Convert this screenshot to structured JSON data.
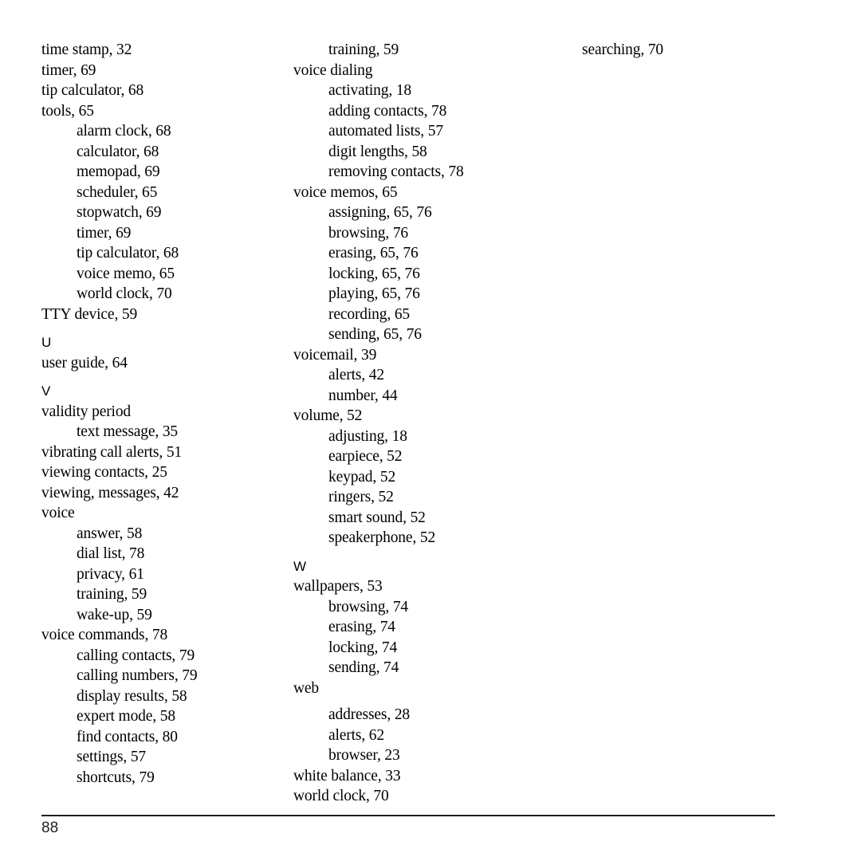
{
  "document": {
    "type": "book-index-page",
    "page_number": "88"
  },
  "footer": {
    "page_number": "88"
  },
  "columns": [
    {
      "id": "column-1",
      "entries": [
        {
          "text": "time stamp, 32",
          "level": 1
        },
        {
          "text": "timer, 69",
          "level": 1
        },
        {
          "text": "tip calculator, 68",
          "level": 1
        },
        {
          "text": "tools, 65",
          "level": 1
        },
        {
          "text": "alarm clock, 68",
          "level": 2
        },
        {
          "text": "calculator, 68",
          "level": 2
        },
        {
          "text": "memopad, 69",
          "level": 2
        },
        {
          "text": "scheduler, 65",
          "level": 2
        },
        {
          "text": "stopwatch, 69",
          "level": 2
        },
        {
          "text": "timer, 69",
          "level": 2
        },
        {
          "text": "tip calculator, 68",
          "level": 2
        },
        {
          "text": "voice memo, 65",
          "level": 2
        },
        {
          "text": "world clock, 70",
          "level": 2
        },
        {
          "text": "TTY device, 59",
          "level": 1
        },
        {
          "text": "U",
          "level": 0,
          "kind": "section-letter"
        },
        {
          "text": "user guide, 64",
          "level": 1
        },
        {
          "text": "V",
          "level": 0,
          "kind": "section-letter"
        },
        {
          "text": "validity period",
          "level": 1
        },
        {
          "text": "text message, 35",
          "level": 2
        },
        {
          "text": "vibrating call alerts, 51",
          "level": 1
        },
        {
          "text": "viewing contacts, 25",
          "level": 1
        },
        {
          "text": "viewing, messages, 42",
          "level": 1
        },
        {
          "text": "voice",
          "level": 1
        },
        {
          "text": "answer, 58",
          "level": 2
        },
        {
          "text": "dial list, 78",
          "level": 2
        },
        {
          "text": "privacy, 61",
          "level": 2
        },
        {
          "text": "training, 59",
          "level": 2
        },
        {
          "text": "wake-up, 59",
          "level": 2
        },
        {
          "text": "voice commands, 78",
          "level": 1
        },
        {
          "text": "calling contacts, 79",
          "level": 2
        },
        {
          "text": "calling numbers, 79",
          "level": 2
        },
        {
          "text": "display results, 58",
          "level": 2
        },
        {
          "text": "expert mode, 58",
          "level": 2
        },
        {
          "text": "find contacts, 80",
          "level": 2
        },
        {
          "text": "settings, 57",
          "level": 2
        },
        {
          "text": "shortcuts, 79",
          "level": 2
        }
      ]
    },
    {
      "id": "column-2",
      "entries": [
        {
          "text": "training, 59",
          "level": 2
        },
        {
          "text": "voice dialing",
          "level": 1
        },
        {
          "text": "activating, 18",
          "level": 2
        },
        {
          "text": "adding contacts, 78",
          "level": 2
        },
        {
          "text": "automated lists, 57",
          "level": 2
        },
        {
          "text": "digit lengths, 58",
          "level": 2
        },
        {
          "text": "removing contacts, 78",
          "level": 2
        },
        {
          "text": "voice memos, 65",
          "level": 1
        },
        {
          "text": "assigning, 65, 76",
          "level": 2
        },
        {
          "text": "browsing, 76",
          "level": 2
        },
        {
          "text": "erasing, 65, 76",
          "level": 2
        },
        {
          "text": "locking, 65, 76",
          "level": 2
        },
        {
          "text": "playing, 65, 76",
          "level": 2
        },
        {
          "text": "recording, 65",
          "level": 2
        },
        {
          "text": "sending, 65, 76",
          "level": 2
        },
        {
          "text": "voicemail, 39",
          "level": 1
        },
        {
          "text": "alerts, 42",
          "level": 2
        },
        {
          "text": "number, 44",
          "level": 2
        },
        {
          "text": "volume, 52",
          "level": 1
        },
        {
          "text": "adjusting, 18",
          "level": 2
        },
        {
          "text": "earpiece, 52",
          "level": 2
        },
        {
          "text": "keypad, 52",
          "level": 2
        },
        {
          "text": "ringers, 52",
          "level": 2
        },
        {
          "text": "smart sound, 52",
          "level": 2
        },
        {
          "text": "speakerphone, 52",
          "level": 2
        },
        {
          "text": "W",
          "level": 0,
          "kind": "section-letter"
        },
        {
          "text": "wallpapers, 53",
          "level": 1
        },
        {
          "text": "browsing, 74",
          "level": 2
        },
        {
          "text": "erasing, 74",
          "level": 2
        },
        {
          "text": "locking, 74",
          "level": 2
        },
        {
          "text": "sending, 74",
          "level": 2
        },
        {
          "text": "web",
          "level": 1,
          "gap_after": true
        },
        {
          "text": "addresses, 28",
          "level": 2
        },
        {
          "text": "alerts, 62",
          "level": 2
        },
        {
          "text": "browser, 23",
          "level": 2
        },
        {
          "text": "white balance, 33",
          "level": 1
        },
        {
          "text": "world clock, 70",
          "level": 1
        }
      ]
    },
    {
      "id": "column-3",
      "entries": [
        {
          "text": "searching, 70",
          "level": 2
        }
      ]
    }
  ]
}
